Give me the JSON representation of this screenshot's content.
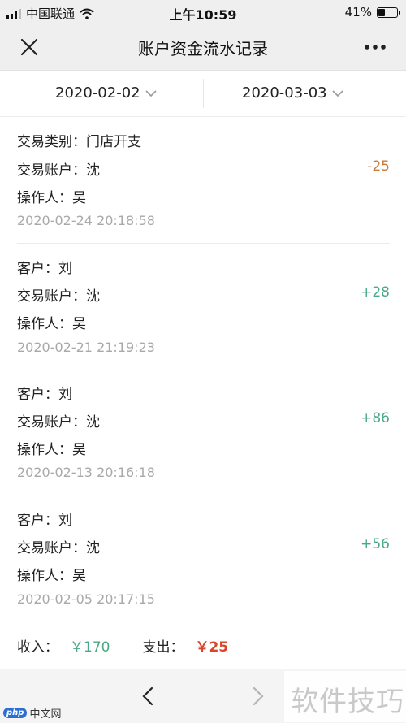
{
  "status_bar": {
    "carrier": "中国联通",
    "time": "上午10:59",
    "battery": "41%",
    "battery_level": 0.41
  },
  "nav": {
    "title": "账户资金流水记录",
    "close_icon": "close-icon",
    "more_icon": "more-icon"
  },
  "filters": {
    "start_date": "2020-02-02",
    "end_date": "2020-03-03"
  },
  "records": [
    {
      "line1": "交易类别：门店开支",
      "line2": "交易账户：沈",
      "line3": "操作人：吴",
      "time": "2020-02-24 20:18:58",
      "amount": "-25",
      "type": "neg"
    },
    {
      "line1": "客户：刘",
      "line2": "交易账户：沈",
      "line3": "操作人：吴",
      "time": "2020-02-21 21:19:23",
      "amount": "+28",
      "type": "pos"
    },
    {
      "line1": "客户：刘",
      "line2": "交易账户：沈",
      "line3": "操作人：吴",
      "time": "2020-02-13 20:16:18",
      "amount": "+86",
      "type": "pos"
    },
    {
      "line1": "客户：刘",
      "line2": "交易账户：沈",
      "line3": "操作人：吴",
      "time": "2020-02-05 20:17:15",
      "amount": "+56",
      "type": "pos"
    }
  ],
  "totals": {
    "income_label": "收入：",
    "income_value": "￥170",
    "expense_label": "支出：",
    "expense_value": "￥25"
  },
  "watermarks": {
    "php_badge": "php",
    "php_text": "中文网",
    "site": "软件技巧"
  },
  "colors": {
    "positive": "#4aa884",
    "negative": "#c77a3a",
    "expense": "#d9452b"
  }
}
